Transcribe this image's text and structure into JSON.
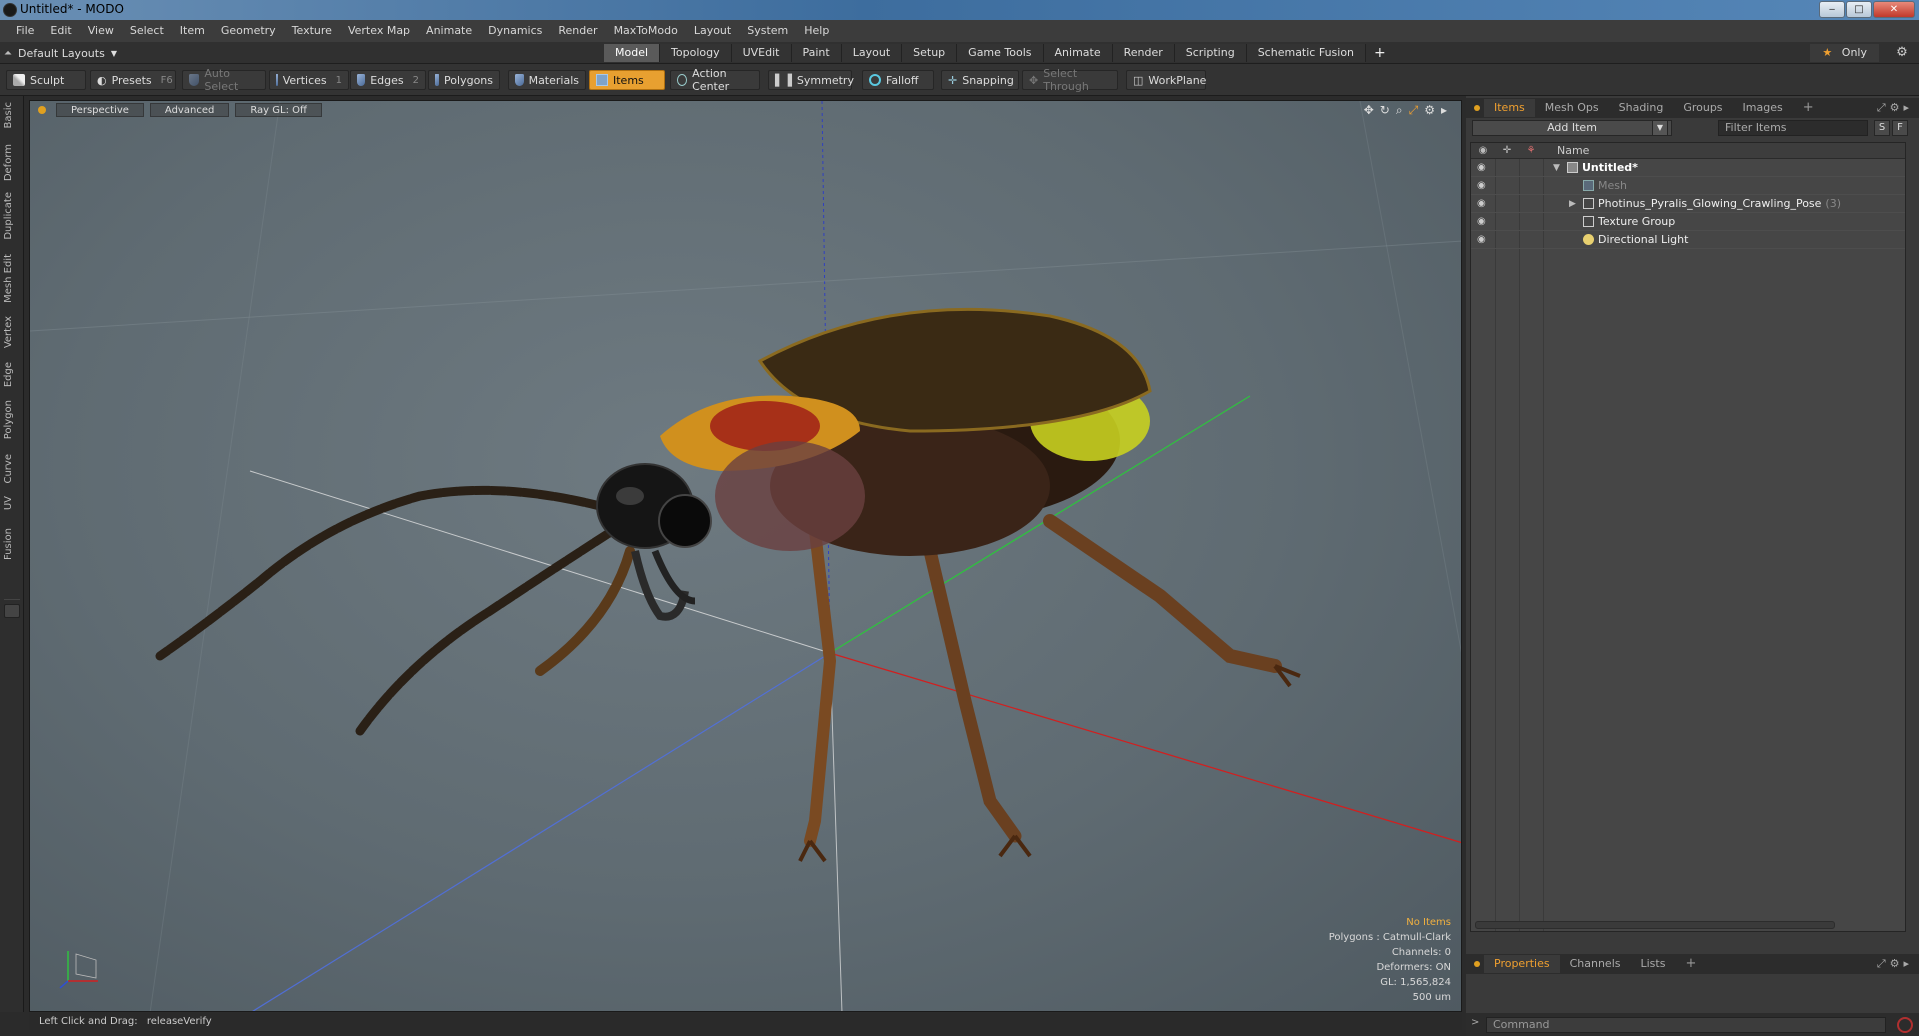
{
  "window": {
    "title": "Untitled* - MODO",
    "minimize": "‒",
    "maximize": "□",
    "close": "✕"
  },
  "menu": [
    "File",
    "Edit",
    "View",
    "Select",
    "Item",
    "Geometry",
    "Texture",
    "Vertex Map",
    "Animate",
    "Dynamics",
    "Render",
    "MaxToModo",
    "Layout",
    "System",
    "Help"
  ],
  "layoutbar": {
    "layout_name": "Default Layouts",
    "tabs": [
      "Model",
      "Topology",
      "UVEdit",
      "Paint",
      "Layout",
      "Setup",
      "Game Tools",
      "Animate",
      "Render",
      "Scripting",
      "Schematic Fusion"
    ],
    "active_tab": "Model",
    "add": "+",
    "only_label": "Only",
    "star": "★",
    "gear": "⚙"
  },
  "toolbar": {
    "sculpt": "Sculpt",
    "presets": "Presets",
    "presets_key": "F6",
    "auto_select": "Auto Select",
    "vertices": "Vertices",
    "vertices_key": "1",
    "edges": "Edges",
    "edges_key": "2",
    "polygons": "Polygons",
    "materials": "Materials",
    "items": "Items",
    "action_center": "Action Center",
    "symmetry": "Symmetry",
    "falloff": "Falloff",
    "snapping": "Snapping",
    "select_through": "Select Through",
    "workplane": "WorkPlane"
  },
  "left_tabs": [
    "Basic",
    "Deform",
    "Duplicate",
    "Mesh Edit",
    "Vertex",
    "Edge",
    "Polygon",
    "Curve",
    "UV",
    "Fusion"
  ],
  "viewport": {
    "view": "Perspective",
    "mode": "Advanced",
    "raygl": "Ray GL: Off",
    "icons": [
      "✥",
      "↻",
      "⌕",
      "⤢",
      "⚙",
      "▸"
    ],
    "stats": {
      "selection": "No Items",
      "polygons": "Polygons : Catmull-Clark",
      "channels": "Channels: 0",
      "deformers": "Deformers: ON",
      "gl": "GL: 1,565,824",
      "scale": "500 um"
    }
  },
  "status": {
    "label": "Left Click and Drag:",
    "value": "releaseVerify"
  },
  "items_panel": {
    "tabs": [
      "Items",
      "Mesh Ops",
      "Shading",
      "Groups",
      "Images"
    ],
    "active_tab": "Items",
    "add_tab": "+",
    "add_item": "Add Item",
    "filter_placeholder": "Filter Items",
    "s_btn": "S",
    "f_btn": "F",
    "name_header": "Name",
    "tree": [
      {
        "label": "Untitled*",
        "level": 0,
        "style": "bold",
        "icon": "scene-icon",
        "expander": "▼"
      },
      {
        "label": "Mesh",
        "level": 1,
        "style": "dim",
        "icon": "mesh-icon",
        "expander": ""
      },
      {
        "label": "Photinus_Pyralis_Glowing_Crawling_Pose",
        "count": "(3)",
        "level": 1,
        "style": "normal",
        "icon": "group-icon",
        "expander": "▶"
      },
      {
        "label": "Texture Group",
        "level": 1,
        "style": "normal",
        "icon": "texture-group-icon",
        "expander": ""
      },
      {
        "label": "Directional Light",
        "level": 1,
        "style": "normal",
        "icon": "light-icon",
        "expander": ""
      }
    ]
  },
  "properties_panel": {
    "tabs": [
      "Properties",
      "Channels",
      "Lists"
    ],
    "active_tab": "Properties",
    "add_tab": "+"
  },
  "command": {
    "placeholder": "Command",
    "arrow": ">"
  },
  "colors": {
    "accent": "#f0a030",
    "axis_x": "#d02020",
    "axis_y": "#30c040",
    "axis_z": "#3050d0",
    "viewport_bg": "#6a767d"
  }
}
